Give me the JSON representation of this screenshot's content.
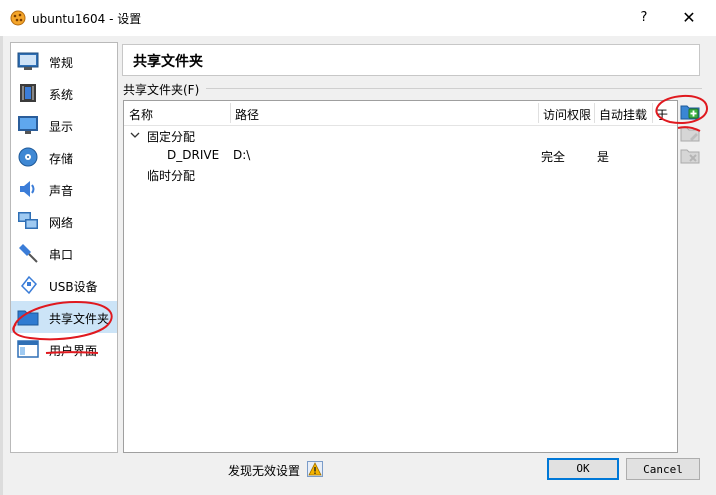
{
  "window": {
    "title": "ubuntu1604 - 设置",
    "help_label": "?",
    "close_label": "✕"
  },
  "sidebar": {
    "items": [
      {
        "label": "常规",
        "icon": "general-icon"
      },
      {
        "label": "系统",
        "icon": "system-icon"
      },
      {
        "label": "显示",
        "icon": "display-icon"
      },
      {
        "label": "存储",
        "icon": "storage-icon"
      },
      {
        "label": "声音",
        "icon": "audio-icon"
      },
      {
        "label": "网络",
        "icon": "network-icon"
      },
      {
        "label": "串口",
        "icon": "serial-port-icon"
      },
      {
        "label": "USB设备",
        "icon": "usb-icon"
      },
      {
        "label": "共享文件夹",
        "icon": "shared-folder-icon",
        "selected": true
      },
      {
        "label": "用户界面",
        "icon": "user-interface-icon"
      }
    ]
  },
  "page": {
    "title": "共享文件夹",
    "group_label": "共享文件夹(F)"
  },
  "table": {
    "columns": [
      "名称",
      "路径",
      "访问权限",
      "自动挂载",
      "于"
    ],
    "groups": [
      {
        "label": "固定分配",
        "expanded": true,
        "rows": [
          {
            "name": "D_DRIVE",
            "path": "D:\\",
            "access": "完全",
            "automount": "是",
            "at": ""
          }
        ]
      },
      {
        "label": "临时分配",
        "expanded": false,
        "rows": []
      }
    ]
  },
  "toolbar": {
    "icons": [
      "add-shared-folder-icon",
      "edit-shared-folder-icon",
      "remove-shared-folder-icon"
    ]
  },
  "footer": {
    "invalid_settings_label": "发现无效设置",
    "ok_label": "OK",
    "cancel_label": "Cancel"
  },
  "colors": {
    "accent": "#0078d7",
    "selection": "#cce4f7",
    "annotation": "#e0191f"
  }
}
